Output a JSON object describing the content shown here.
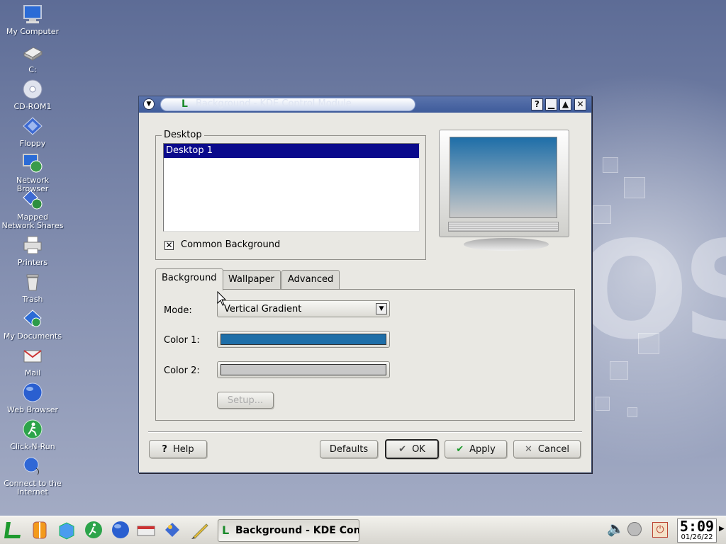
{
  "desktop_icons": [
    {
      "label": "My Computer",
      "icon": "computer-icon"
    },
    {
      "label": "C:",
      "icon": "drive-icon"
    },
    {
      "label": "CD-ROM1",
      "icon": "cdrom-icon"
    },
    {
      "label": "Floppy",
      "icon": "floppy-icon"
    },
    {
      "label": "Network Browser",
      "icon": "network-browser-icon"
    },
    {
      "label": "Mapped Network Shares",
      "icon": "network-shares-icon"
    },
    {
      "label": "Printers",
      "icon": "printer-icon"
    },
    {
      "label": "Trash",
      "icon": "trash-icon"
    },
    {
      "label": "My Documents",
      "icon": "documents-icon"
    },
    {
      "label": "Mail",
      "icon": "mail-icon"
    },
    {
      "label": "Web Browser",
      "icon": "web-browser-icon"
    },
    {
      "label": "Click-N-Run",
      "icon": "click-n-run-icon"
    },
    {
      "label": "Connect to the Internet",
      "icon": "internet-connect-icon"
    }
  ],
  "wallpaper": {
    "logo_text": "OS"
  },
  "window": {
    "title": "Background - KDE Control Module",
    "desktop_group": {
      "title": "Desktop",
      "items": [
        "Desktop 1"
      ],
      "common_background": {
        "label": "Common Background",
        "checked": true
      }
    },
    "tabs": [
      "Background",
      "Wallpaper",
      "Advanced"
    ],
    "active_tab": "Background",
    "background_tab": {
      "mode_label": "Mode:",
      "mode_value": "Vertical Gradient",
      "color1_label": "Color 1:",
      "color1_value": "#1e6ea8",
      "color2_label": "Color 2:",
      "color2_value": "#c8c8c8",
      "setup_label": "Setup..."
    },
    "buttons": {
      "help": "Help",
      "defaults": "Defaults",
      "ok": "OK",
      "apply": "Apply",
      "cancel": "Cancel"
    }
  },
  "taskbar": {
    "task_label": "Background - KDE Control Module",
    "clock_time": "5:09",
    "clock_date": "01/26/22"
  }
}
